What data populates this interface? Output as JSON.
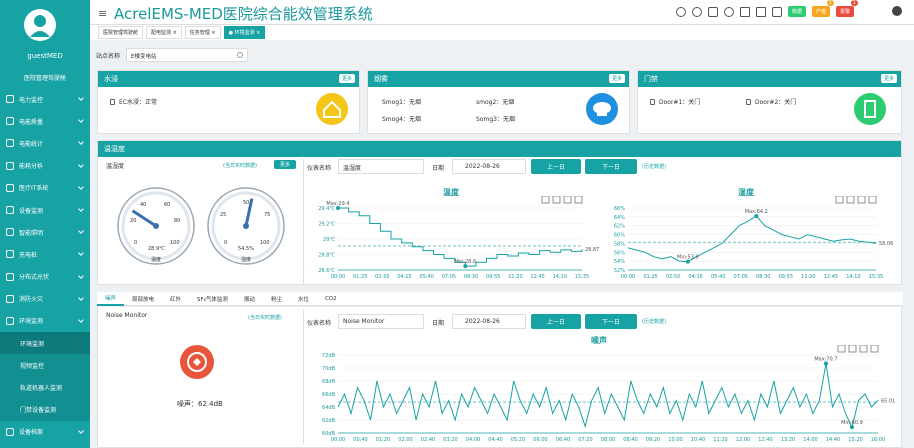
{
  "sidebar": {
    "username": "guestMED",
    "subtitle": "医院管理驾驶舱",
    "items": [
      {
        "label": "电力监控",
        "icon": "power-icon"
      },
      {
        "label": "电能质量",
        "icon": "quality-icon"
      },
      {
        "label": "电能统计",
        "icon": "stats-icon"
      },
      {
        "label": "能耗分析",
        "icon": "analysis-icon"
      },
      {
        "label": "医疗IT系统",
        "icon": "it-icon"
      },
      {
        "label": "设备监测",
        "icon": "device-icon"
      },
      {
        "label": "智能照明",
        "icon": "light-icon"
      },
      {
        "label": "充电桩",
        "icon": "charger-icon"
      },
      {
        "label": "分布式光伏",
        "icon": "solar-icon"
      },
      {
        "label": "消防火灾",
        "icon": "fire-icon"
      },
      {
        "label": "环境监测",
        "icon": "env-icon"
      }
    ],
    "sub_items": [
      "环境监测",
      "视频监控",
      "轨道机器人监测",
      "门禁设备监测"
    ],
    "bottom_item": "设备档案"
  },
  "topbar": {
    "title": "AcrelEMS-MED医院综合能效管理系统",
    "btn_green": "数据",
    "btn_orange": "产值",
    "btn_red": "报警",
    "badge_orange": "1",
    "badge_red": "1"
  },
  "tabs": [
    "医院管理驾驶舱",
    "配电监测 ×",
    "任务管理 ×",
    "● 环境监测 ×"
  ],
  "search": {
    "label": "站点名称",
    "value": "E楼变电站"
  },
  "water": {
    "title": "水浸",
    "more": "更多",
    "item": "EC水浸：正常"
  },
  "smoke": {
    "title": "烟雾",
    "more": "更多",
    "items": [
      "Smog1：无烟",
      "smog2：无烟",
      "Smog4：无烟",
      "Somg3：无烟"
    ]
  },
  "door": {
    "title": "门禁",
    "more": "更多",
    "items": [
      "Door#1：关门",
      "Door#2：关门"
    ]
  },
  "th": {
    "title": "温湿度",
    "panel_title": "温湿度",
    "realtime": "(当日实时数据)",
    "more": "更多",
    "gauge_temp": {
      "value": "28.9℃",
      "label": "温度",
      "ticks": [
        "0",
        "20",
        "40",
        "60",
        "80",
        "100"
      ],
      "val_num": 28.9
    },
    "gauge_hum": {
      "value": "54.5%",
      "label": "湿度",
      "ticks": [
        "0",
        "25",
        "50",
        "75",
        "100"
      ],
      "val_num": 54.5
    },
    "instrument_label": "仪表名称",
    "instrument": "温湿度",
    "date_label": "日期",
    "date": "2022-08-26",
    "prev": "上一日",
    "next": "下一日",
    "history": "(历史数据)"
  },
  "chart_temp": {
    "type": "line",
    "title": "温度",
    "x": [
      "00:00",
      "01:25",
      "02:50",
      "04:15",
      "05:40",
      "07:05",
      "08:30",
      "09:55",
      "11:20",
      "12:45",
      "14:10",
      "15:35"
    ],
    "y_ticks": [
      "29.4℃",
      "29.2℃",
      "29℃",
      "28.8℃",
      "28.6℃"
    ],
    "ylim": [
      28.6,
      29.4
    ],
    "max_label": "Max:29.4",
    "min_label": "Min:28.6",
    "last_label": "28.87",
    "values": [
      29.4,
      29.35,
      29.3,
      29.2,
      29.1,
      29.0,
      28.95,
      28.9,
      28.85,
      28.8,
      28.75,
      28.7,
      28.65,
      28.7,
      28.75,
      28.8,
      28.78,
      28.82,
      28.8,
      28.85,
      28.83,
      28.86,
      28.84,
      28.87
    ]
  },
  "chart_hum": {
    "type": "line",
    "title": "湿度",
    "x": [
      "00:00",
      "01:25",
      "02:50",
      "04:15",
      "05:40",
      "07:05",
      "08:30",
      "09:55",
      "11:20",
      "12:45",
      "14:10",
      "15:35"
    ],
    "y_ticks": [
      "66%",
      "64%",
      "62%",
      "60%",
      "58%",
      "56%",
      "54%",
      "52%"
    ],
    "ylim": [
      52,
      66
    ],
    "max_label": "Max:64.2",
    "min_label": "Min:53.9",
    "last_label": "58.06",
    "values": [
      57,
      56.5,
      56,
      55,
      54.5,
      55,
      54,
      53.9,
      55,
      56,
      57,
      58,
      60,
      62,
      63,
      64.2,
      62,
      61,
      60,
      59.5,
      59,
      60,
      59.5,
      59,
      58.5,
      58.8,
      59,
      58.5,
      58.3,
      58.06
    ]
  },
  "subtabs": [
    "噪声",
    "局部放电",
    "红外",
    "SF₆气体监测",
    "振动",
    "粉尘",
    "水位",
    "CO2"
  ],
  "noise": {
    "panel_title": "Noise Monitor",
    "realtime": "(当日实时数据)",
    "value_label": "噪声：62.4dB",
    "instrument_label": "仪表名称",
    "instrument": "Noise Monitor",
    "date_label": "日期",
    "date": "2022-08-26",
    "prev": "上一日",
    "next": "下一日",
    "history": "(历史数据)"
  },
  "chart_noise": {
    "type": "line",
    "title": "噪声",
    "x": [
      "00:00",
      "00:40",
      "01:20",
      "02:00",
      "02:40",
      "03:20",
      "04:00",
      "04:40",
      "05:20",
      "06:00",
      "06:40",
      "07:20",
      "08:00",
      "08:40",
      "09:20",
      "10:00",
      "10:40",
      "11:20",
      "12:00",
      "12:40",
      "13:20",
      "14:00",
      "14:40",
      "15:20",
      "16:00"
    ],
    "y_ticks": [
      "72dB",
      "70dB",
      "68dB",
      "66dB",
      "64dB",
      "62dB",
      "60dB"
    ],
    "ylim": [
      60,
      72
    ],
    "max_label": "Max:70.7",
    "min_label": "Min:60.9",
    "last_label": "65.01",
    "values": [
      64,
      66,
      63,
      67,
      65,
      62,
      68,
      64,
      66,
      63,
      65,
      67,
      62,
      66,
      64,
      68,
      63,
      65,
      62,
      66,
      64,
      67,
      65,
      63,
      66,
      64,
      62,
      68,
      65,
      63,
      66,
      64,
      67,
      63,
      65,
      62,
      66,
      64,
      61,
      65,
      67,
      63,
      66,
      64,
      62,
      68,
      65,
      63,
      66,
      64,
      67,
      63,
      65,
      62,
      66,
      64,
      68,
      63,
      65,
      67,
      64,
      66,
      63,
      65,
      62,
      66,
      64,
      68,
      63,
      65,
      67,
      64,
      66,
      63,
      65,
      70.7,
      64,
      66,
      63,
      60.9,
      65,
      66,
      64,
      65.01
    ]
  },
  "colors": {
    "accent": "#17a2a4",
    "orange": "#f5a623",
    "red": "#e74c3c",
    "green": "#2ecc71"
  }
}
